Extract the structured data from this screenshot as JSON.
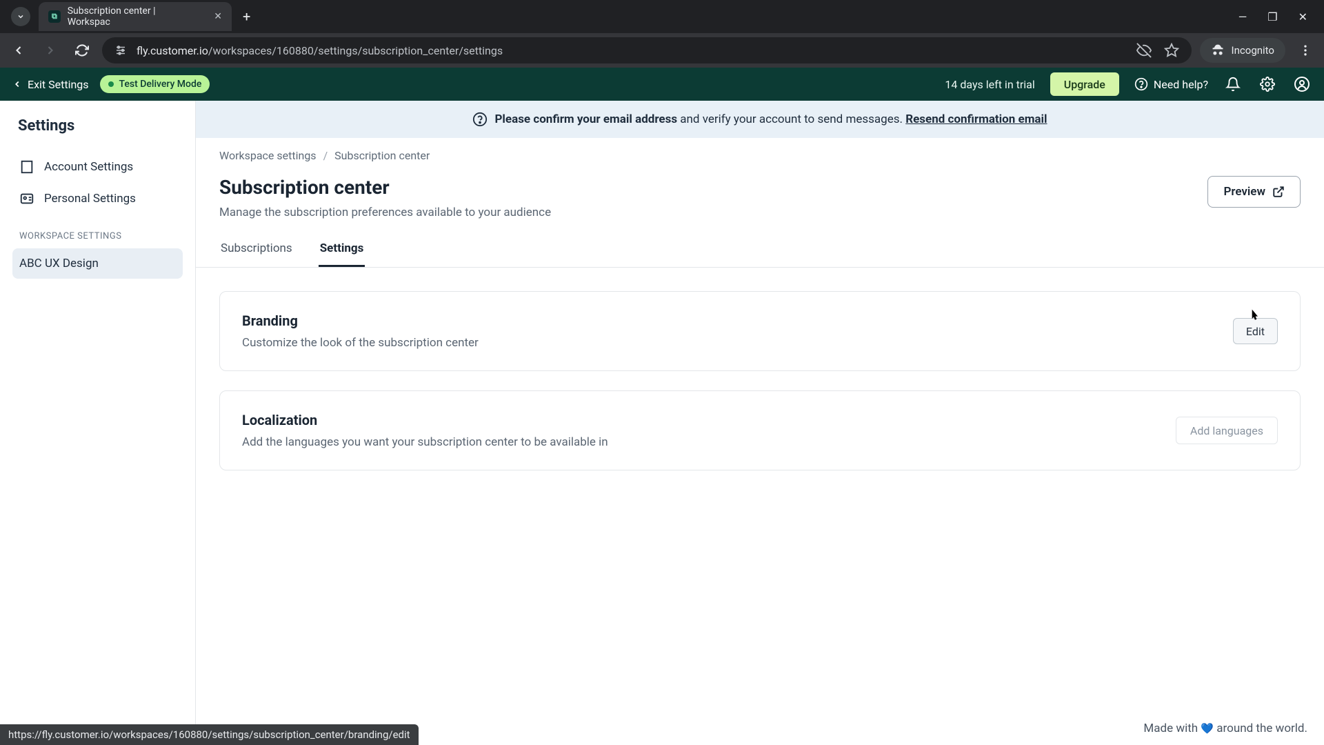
{
  "browser": {
    "tab_title": "Subscription center | Workspac",
    "url_display": "fly.customer.io/workspaces/160880/settings/subscription_center/settings",
    "incognito_label": "Incognito",
    "status_url": "https://fly.customer.io/workspaces/160880/settings/subscription_center/branding/edit"
  },
  "topbar": {
    "exit": "Exit Settings",
    "test_mode": "Test Delivery Mode",
    "trial": "14 days left in trial",
    "upgrade": "Upgrade",
    "help": "Need help?"
  },
  "sidebar": {
    "title": "Settings",
    "account": "Account Settings",
    "personal": "Personal Settings",
    "ws_heading": "WORKSPACE SETTINGS",
    "workspace": "ABC UX Design"
  },
  "banner": {
    "bold": "Please confirm your email address",
    "rest": " and verify your account to send messages. ",
    "link": "Resend confirmation email"
  },
  "crumbs": {
    "root": "Workspace settings",
    "current": "Subscription center"
  },
  "header": {
    "title": "Subscription center",
    "subtitle": "Manage the subscription preferences available to your audience",
    "preview": "Preview"
  },
  "tabs": {
    "subscriptions": "Subscriptions",
    "settings": "Settings"
  },
  "cards": {
    "branding": {
      "title": "Branding",
      "desc": "Customize the look of the subscription center",
      "action": "Edit"
    },
    "localization": {
      "title": "Localization",
      "desc": "Add the languages you want your subscription center to be available in",
      "action": "Add languages"
    }
  },
  "footer": "Made with 💙 around the world."
}
